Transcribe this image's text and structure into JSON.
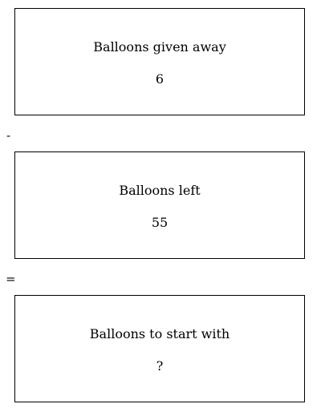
{
  "boxes": [
    {
      "label": "Balloons given away",
      "value": "6"
    },
    {
      "label": "Balloons left",
      "value": "55"
    },
    {
      "label": "Balloons to start with",
      "value": "?"
    }
  ],
  "operators": [
    "-",
    "="
  ]
}
